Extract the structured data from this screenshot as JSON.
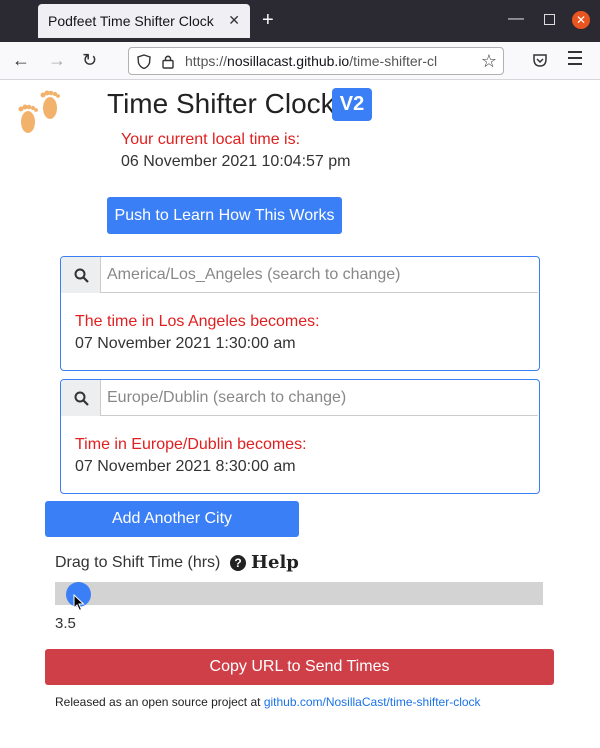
{
  "browser": {
    "tab_title": "Podfeet Time Shifter Clock",
    "url_prefix": "https://",
    "url_host": "nosillacast.github.io",
    "url_path": "/time-shifter-cl"
  },
  "header": {
    "title": "Time Shifter Clock",
    "badge": "V2",
    "local_label": "Your current local time is:",
    "local_time": "06 November 2021 10:04:57 pm"
  },
  "learn_button": "Push to Learn How This Works",
  "cities": [
    {
      "placeholder": "America/Los_Angeles (search to change)",
      "label": "The time in Los Angeles becomes:",
      "time": "07 November 2021 1:30:00 am"
    },
    {
      "placeholder": "Europe/Dublin (search to change)",
      "label": "Time in Europe/Dublin becomes:",
      "time": "07 November 2021 8:30:00 am"
    }
  ],
  "add_city_button": "Add Another City",
  "slider": {
    "label": "Drag to Shift Time (hrs)",
    "help_icon_glyph": "?",
    "help": "Help",
    "value": "3.5",
    "fraction": 0.047
  },
  "copy_button": "Copy URL to Send Times",
  "footer": {
    "text": "Released as an open source project at ",
    "link": "github.com/NosillaCast/time-shifter-clock"
  },
  "colors": {
    "accent": "#3a7ff5",
    "alert_text": "#e02020",
    "copy_button": "#cf3f48"
  }
}
